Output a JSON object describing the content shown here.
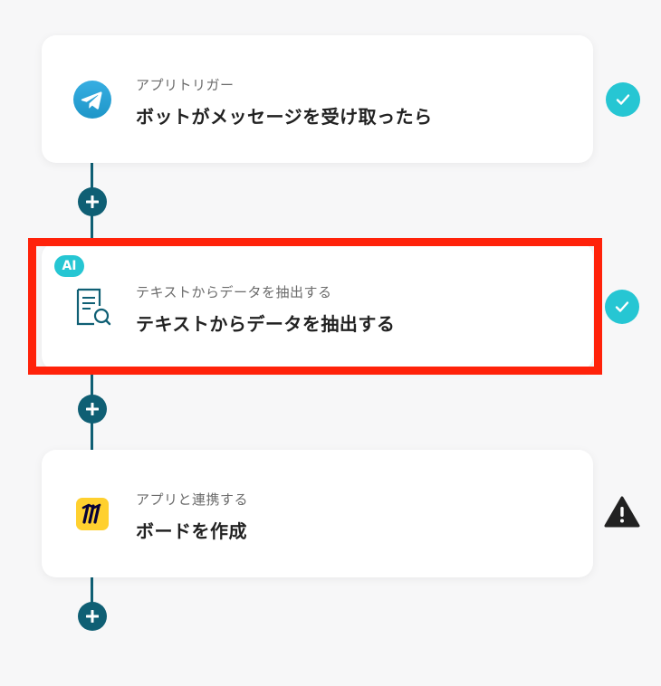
{
  "steps": [
    {
      "sub": "アプリトリガー",
      "title": "ボットがメッセージを受け取ったら",
      "icon": "telegram-icon",
      "status": "complete"
    },
    {
      "badge": "AI",
      "sub": "テキストからデータを抽出する",
      "title": "テキストからデータを抽出する",
      "icon": "document-search-icon",
      "status": "complete"
    },
    {
      "sub": "アプリと連携する",
      "title": "ボードを作成",
      "icon": "miro-icon",
      "status": "warning"
    }
  ],
  "colors": {
    "connector": "#0f5f74",
    "check": "#26c6d3",
    "highlight": "#ff220a",
    "telegram": "#2aa3e0",
    "miro_bg": "#ffd02f"
  }
}
